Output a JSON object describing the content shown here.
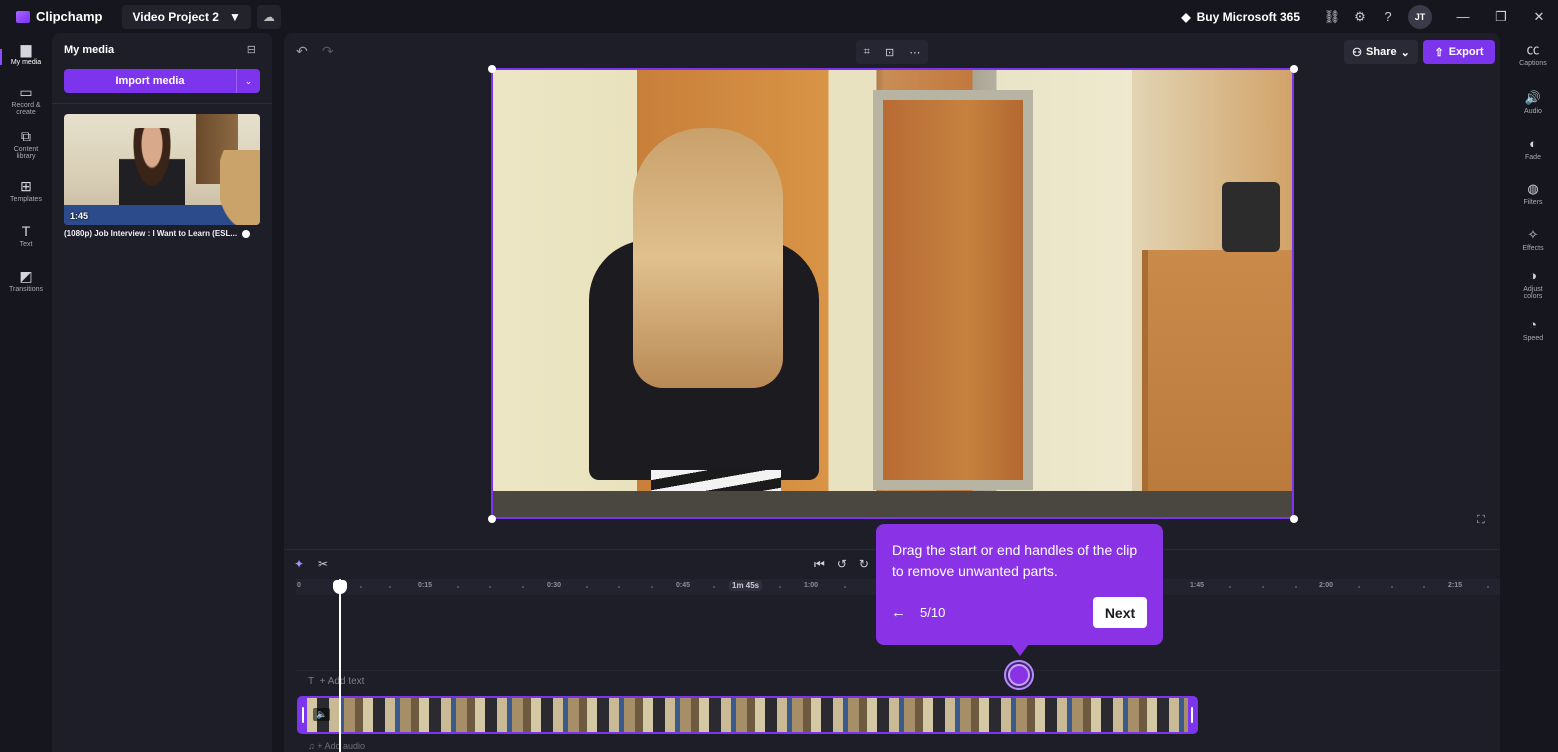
{
  "app": {
    "name": "Clipchamp",
    "project": "Video Project 2"
  },
  "topbar": {
    "buy": "Buy Microsoft 365",
    "avatar": "JT"
  },
  "left_rail": [
    {
      "label": "My media",
      "icon": "folder-icon"
    },
    {
      "label": "Record &\ncreate",
      "icon": "camera-icon"
    },
    {
      "label": "Content\nlibrary",
      "icon": "library-icon"
    },
    {
      "label": "Templates",
      "icon": "templates-icon"
    },
    {
      "label": "Text",
      "icon": "text-icon"
    },
    {
      "label": "Transitions",
      "icon": "transitions-icon"
    }
  ],
  "media": {
    "title": "My media",
    "import_label": "Import media",
    "item": {
      "duration": "1:45",
      "name": "(1080p) Job Interview :   I Want to Learn (ESL..."
    }
  },
  "editor": {
    "share_label": "Share",
    "export_label": "Export"
  },
  "timeline": {
    "ticks": [
      "0",
      "0:15",
      "0:30",
      "0:45",
      "1:00",
      "1:45",
      "2:00",
      "2:15"
    ],
    "duration_badge": "1m 45s",
    "add_text": "+ Add text",
    "add_audio": "+ Add audio"
  },
  "tooltip": {
    "text": "Drag the start or end handles of the clip to remove unwanted parts.",
    "step": "5/10",
    "next_label": "Next"
  },
  "right_rail": [
    {
      "label": "Captions",
      "icon": "captions-icon"
    },
    {
      "label": "Audio",
      "icon": "audio-icon"
    },
    {
      "label": "Fade",
      "icon": "fade-icon"
    },
    {
      "label": "Filters",
      "icon": "filters-icon"
    },
    {
      "label": "Effects",
      "icon": "effects-icon"
    },
    {
      "label": "Adjust\ncolors",
      "icon": "adjust-colors-icon"
    },
    {
      "label": "Speed",
      "icon": "speed-icon"
    }
  ],
  "colors": {
    "accent": "#7c34ec",
    "tooltip": "#8a33e6",
    "background": "#16161f",
    "panel": "#1e1e29"
  }
}
